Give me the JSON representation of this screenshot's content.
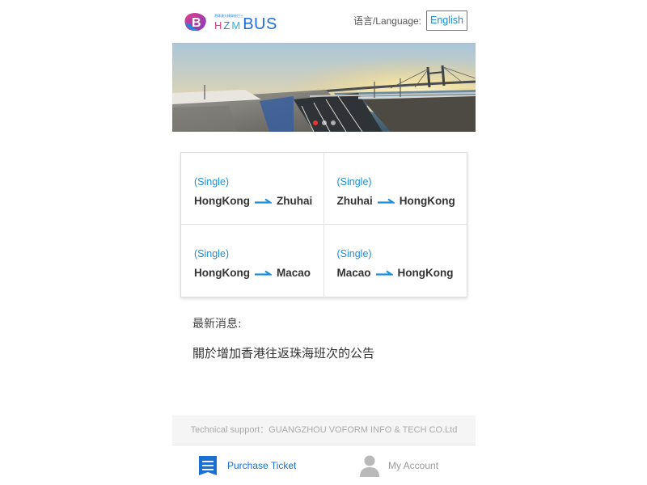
{
  "header": {
    "logo_text": "BUS",
    "logo_hzm": "HZM",
    "logo_small_text": "港珠澳大橋穿梭巴士",
    "language_label": "语言/Language:",
    "language_value": "English"
  },
  "banner": {
    "slides": 3,
    "active_slide": 1
  },
  "routes": [
    {
      "type": "(Single)",
      "from": "HongKong",
      "to": "Zhuhai"
    },
    {
      "type": "(Single)",
      "from": "Zhuhai",
      "to": "HongKong"
    },
    {
      "type": "(Single)",
      "from": "HongKong",
      "to": "Macao"
    },
    {
      "type": "(Single)",
      "from": "Macao",
      "to": "HongKong"
    }
  ],
  "news": {
    "title": "最新消息:",
    "items": [
      "關於增加香港往返珠海班次的公告"
    ]
  },
  "footer": {
    "support_text": "Technical support：GUANGZHOU VOFORM INFO & TECH CO.Ltd"
  },
  "tabbar": {
    "purchase_label": "Purchase Ticket",
    "account_label": "My Account"
  },
  "colors": {
    "accent": "#1a8fd8",
    "brand_blue": "#1e6fd9",
    "brand_pink": "#e23b8e",
    "active_dot": "#e53935"
  },
  "icons": {
    "logo": "hzm-bus-logo-icon",
    "route_arrow": "right-arrow-icon",
    "purchase": "ticket-list-icon",
    "account": "user-silhouette-icon"
  }
}
